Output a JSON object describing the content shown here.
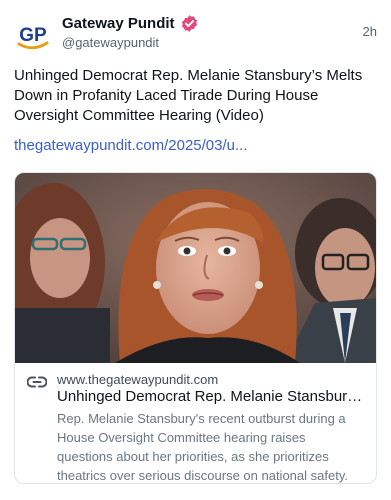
{
  "post": {
    "author": {
      "display_name": "Gateway Pundit",
      "handle": "@gatewaypundit",
      "avatar_logo": "GP",
      "verified_icon": "verified-check-icon"
    },
    "timestamp": "2h",
    "text": "Unhinged Democrat Rep. Melanie Stansbury’s Melts Down in Profanity Laced Tirade During House Oversight Committee Hearing (Video)",
    "link_text": "thegatewaypundit.com/2025/03/u..."
  },
  "link_card": {
    "image": "photo-of-woman-speaking-at-hearing",
    "icon": "link-icon",
    "domain": "www.thegatewaypundit.com",
    "title": "Unhinged Democrat Rep. Melanie Stansbury's ...",
    "description": "Rep. Melanie Stansbury's recent outburst during a House Oversight Committee hearing raises questions about her priorities, as she prioritizes theatrics over serious discourse on national safety."
  },
  "colors": {
    "link": "#3a5fc9",
    "verified_badge": "#e5487a",
    "logo_blue": "#1e3f8c",
    "logo_gold": "#e3a21a"
  }
}
